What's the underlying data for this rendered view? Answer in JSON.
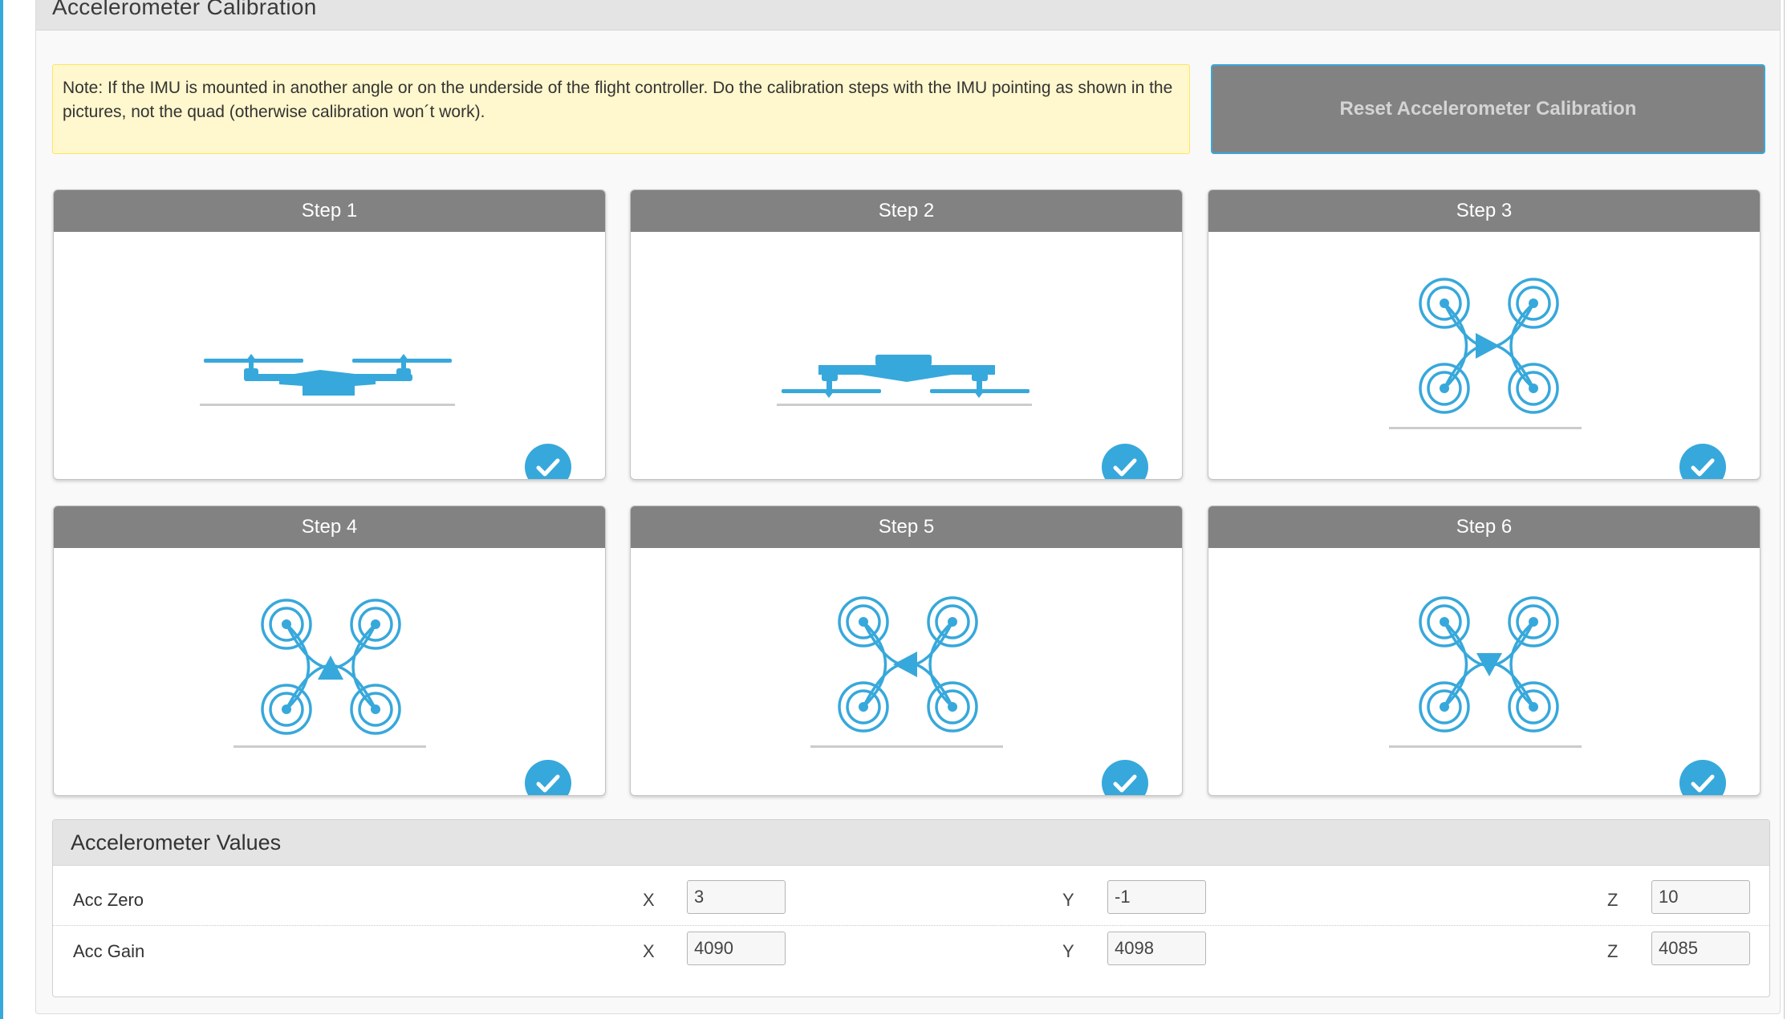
{
  "panel": {
    "title": "Accelerometer Calibration"
  },
  "note": {
    "text": "Note: If the IMU is mounted in another angle or on the underside of the flight controller. Do the calibration steps with the IMU pointing as shown in the pictures, not the quad (otherwise calibration won´t work)."
  },
  "reset_button": {
    "label": "Reset Accelerometer Calibration"
  },
  "steps": [
    {
      "label": "Step 1",
      "image": "quad-side-up",
      "status": "checkmark-icon"
    },
    {
      "label": "Step 2",
      "image": "quad-side-inverted",
      "status": "checkmark-icon"
    },
    {
      "label": "Step 3",
      "image": "quad-top-arrow-right",
      "status": "checkmark-icon"
    },
    {
      "label": "Step 4",
      "image": "quad-top-arrow-up",
      "status": "checkmark-icon"
    },
    {
      "label": "Step 5",
      "image": "quad-top-arrow-left",
      "status": "checkmark-icon"
    },
    {
      "label": "Step 6",
      "image": "quad-top-arrow-down",
      "status": "checkmark-icon"
    }
  ],
  "values": {
    "title": "Accelerometer Values",
    "rows": [
      {
        "label": "Acc Zero",
        "x_label": "X",
        "x": "3",
        "y_label": "Y",
        "y": "-1",
        "z_label": "Z",
        "z": "10"
      },
      {
        "label": "Acc Gain",
        "x_label": "X",
        "x": "4090",
        "y_label": "Y",
        "y": "4098",
        "z_label": "Z",
        "z": "4085"
      }
    ]
  },
  "colors": {
    "accent": "#37a8db",
    "header_gray": "#828282",
    "note_bg": "#fff7cd",
    "note_border": "#ffe55f"
  }
}
